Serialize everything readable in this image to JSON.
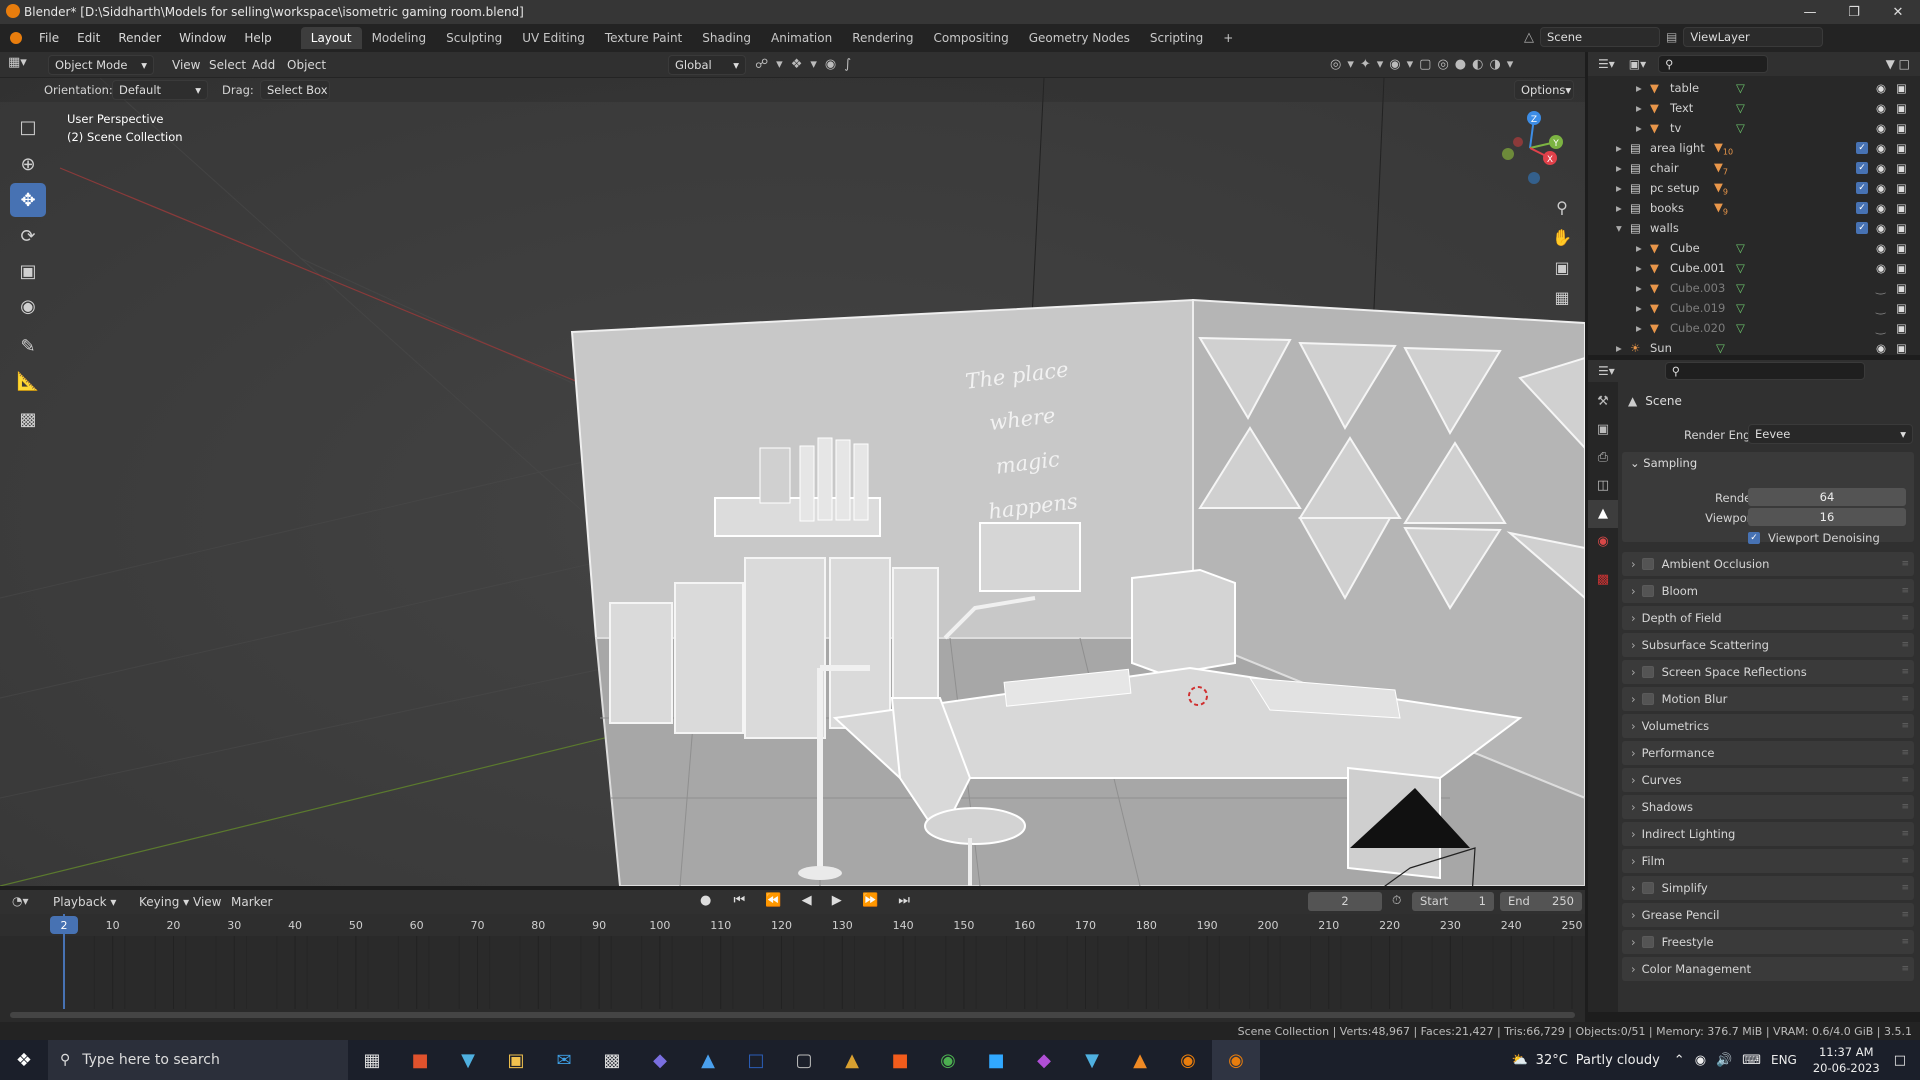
{
  "window": {
    "title": "Blender* [D:\\Siddharth\\Models for selling\\workspace\\isometric gaming room.blend]"
  },
  "menu": [
    "File",
    "Edit",
    "Render",
    "Window",
    "Help"
  ],
  "workspaces": [
    "Layout",
    "Modeling",
    "Sculpting",
    "UV Editing",
    "Texture Paint",
    "Shading",
    "Animation",
    "Rendering",
    "Compositing",
    "Geometry Nodes",
    "Scripting"
  ],
  "active_workspace": "Layout",
  "scene": {
    "scene_name": "Scene",
    "view_layer": "ViewLayer"
  },
  "viewport_header": {
    "mode": "Object Mode",
    "menus": [
      "View",
      "Select",
      "Add",
      "Object"
    ],
    "transform": "Global",
    "options": "Options"
  },
  "tool_settings": {
    "orientation_label": "Orientation:",
    "orientation_value": "Default",
    "drag_label": "Drag:",
    "drag_value": "Select Box"
  },
  "viewport_info": {
    "line1": "User Perspective",
    "line2": "(2) Scene Collection"
  },
  "scene_text": {
    "line1": "The place where",
    "line2": "magic happens"
  },
  "gizmo": {
    "z": "Z",
    "y": "Y",
    "x": "X"
  },
  "outliner": {
    "rows": [
      {
        "name": "table",
        "dim": false,
        "checkbox": false,
        "badge": ""
      },
      {
        "name": "Text",
        "dim": false,
        "checkbox": false,
        "badge": ""
      },
      {
        "name": "tv",
        "dim": false,
        "checkbox": false,
        "badge": ""
      },
      {
        "name": "area light",
        "dim": false,
        "checkbox": true,
        "badge": "10"
      },
      {
        "name": "chair",
        "dim": false,
        "checkbox": true,
        "badge": "7"
      },
      {
        "name": "pc setup",
        "dim": false,
        "checkbox": true,
        "badge": "9"
      },
      {
        "name": "books",
        "dim": false,
        "checkbox": true,
        "badge": "9"
      },
      {
        "name": "walls",
        "dim": false,
        "checkbox": true,
        "badge": ""
      },
      {
        "name": "Cube",
        "dim": false,
        "checkbox": false,
        "badge": ""
      },
      {
        "name": "Cube.001",
        "dim": false,
        "checkbox": false,
        "badge": ""
      },
      {
        "name": "Cube.003",
        "dim": true,
        "checkbox": false,
        "badge": ""
      },
      {
        "name": "Cube.019",
        "dim": true,
        "checkbox": false,
        "badge": ""
      },
      {
        "name": "Cube.020",
        "dim": true,
        "checkbox": false,
        "badge": ""
      },
      {
        "name": "Sun",
        "dim": false,
        "checkbox": false,
        "badge": ""
      }
    ]
  },
  "properties": {
    "context": "Scene",
    "render_engine_label": "Render Engine",
    "render_engine": "Eevee",
    "sampling": {
      "title": "Sampling",
      "render_label": "Render",
      "render_value": "64",
      "viewport_label": "Viewport",
      "viewport_value": "16",
      "denoise_label": "Viewport Denoising"
    },
    "panels": [
      {
        "label": "Ambient Occlusion",
        "checkbox": true
      },
      {
        "label": "Bloom",
        "checkbox": true
      },
      {
        "label": "Depth of Field",
        "checkbox": false
      },
      {
        "label": "Subsurface Scattering",
        "checkbox": false
      },
      {
        "label": "Screen Space Reflections",
        "checkbox": true
      },
      {
        "label": "Motion Blur",
        "checkbox": true
      },
      {
        "label": "Volumetrics",
        "checkbox": false
      },
      {
        "label": "Performance",
        "checkbox": false
      },
      {
        "label": "Curves",
        "checkbox": false
      },
      {
        "label": "Shadows",
        "checkbox": false
      },
      {
        "label": "Indirect Lighting",
        "checkbox": false
      },
      {
        "label": "Film",
        "checkbox": false
      },
      {
        "label": "Simplify",
        "checkbox": true
      },
      {
        "label": "Grease Pencil",
        "checkbox": false
      },
      {
        "label": "Freestyle",
        "checkbox": true
      },
      {
        "label": "Color Management",
        "checkbox": false
      }
    ]
  },
  "timeline": {
    "menus": [
      "Playback",
      "Keying",
      "View",
      "Marker"
    ],
    "current_frame": "2",
    "start_label": "Start",
    "start": "1",
    "end_label": "End",
    "end": "250",
    "ruler": [
      "10",
      "20",
      "30",
      "40",
      "50",
      "60",
      "70",
      "80",
      "90",
      "100",
      "110",
      "120",
      "130",
      "140",
      "150",
      "160",
      "170",
      "180",
      "190",
      "200",
      "210",
      "220",
      "230",
      "240",
      "250"
    ],
    "playhead_label": "2"
  },
  "statusbar": {
    "text": "Scene Collection | Verts:48,967 | Faces:21,427 | Tris:66,729 | Objects:0/51 | Memory: 376.7 MiB | VRAM: 0.6/4.0 GiB | 3.5.1"
  },
  "taskbar": {
    "search_placeholder": "Type here to search",
    "weather_temp": "32°C",
    "weather_text": "Partly cloudy",
    "lang": "ENG",
    "time": "11:37 AM",
    "date": "20-06-2023"
  },
  "colors": {
    "accent": "#4772b3",
    "x_axis": "#e0414a",
    "y_axis": "#7cb342",
    "z_axis": "#3d8de6",
    "outliner_icon": "#e8964a",
    "mesh_icon": "#6bc36b"
  }
}
